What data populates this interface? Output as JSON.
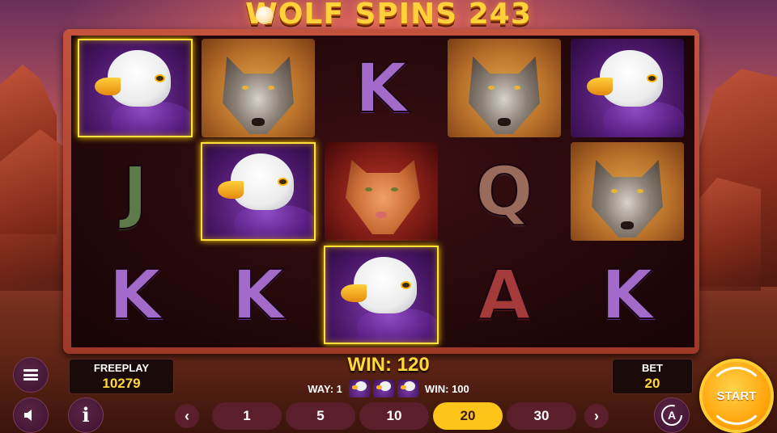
{
  "game": {
    "title": "WOLF SPINS 243"
  },
  "reels": [
    {
      "col": 0,
      "row": 0,
      "symbol": "eagle",
      "winning": true
    },
    {
      "col": 1,
      "row": 0,
      "symbol": "wolf",
      "winning": false
    },
    {
      "col": 2,
      "row": 0,
      "symbol": "K",
      "winning": false
    },
    {
      "col": 3,
      "row": 0,
      "symbol": "wolf",
      "winning": false
    },
    {
      "col": 4,
      "row": 0,
      "symbol": "eagle",
      "winning": false
    },
    {
      "col": 0,
      "row": 1,
      "symbol": "J",
      "winning": false
    },
    {
      "col": 1,
      "row": 1,
      "symbol": "eagle",
      "winning": true
    },
    {
      "col": 2,
      "row": 1,
      "symbol": "cougar",
      "winning": false
    },
    {
      "col": 3,
      "row": 1,
      "symbol": "Q",
      "winning": false
    },
    {
      "col": 4,
      "row": 1,
      "symbol": "wolf",
      "winning": false
    },
    {
      "col": 0,
      "row": 2,
      "symbol": "K",
      "winning": false
    },
    {
      "col": 1,
      "row": 2,
      "symbol": "K",
      "winning": false
    },
    {
      "col": 2,
      "row": 2,
      "symbol": "eagle",
      "winning": true
    },
    {
      "col": 3,
      "row": 2,
      "symbol": "A",
      "winning": false
    },
    {
      "col": 4,
      "row": 2,
      "symbol": "K",
      "winning": false
    }
  ],
  "balance": {
    "label": "FREEPLAY",
    "value": "10279"
  },
  "bet": {
    "label": "BET",
    "value": "20"
  },
  "win": {
    "total_text": "WIN: 120",
    "way_text": "WAY: 1",
    "way_symbol": "eagle",
    "way_symbol_count": 3,
    "line_win_text": "WIN: 100"
  },
  "bet_options": [
    {
      "label": "1",
      "active": false
    },
    {
      "label": "5",
      "active": false
    },
    {
      "label": "10",
      "active": false
    },
    {
      "label": "20",
      "active": true
    },
    {
      "label": "30",
      "active": false
    }
  ],
  "controls": {
    "start_label": "START",
    "auto_label": "A",
    "info_label": "i",
    "prev_arrow": "‹",
    "next_arrow": "›"
  },
  "colors": {
    "accent_gold": "#ffd83a",
    "win_frame": "#ffe23a",
    "bet_active": "#ffc41a",
    "bet_inactive": "#5a1f2a",
    "start_button": "#ffa40a"
  }
}
